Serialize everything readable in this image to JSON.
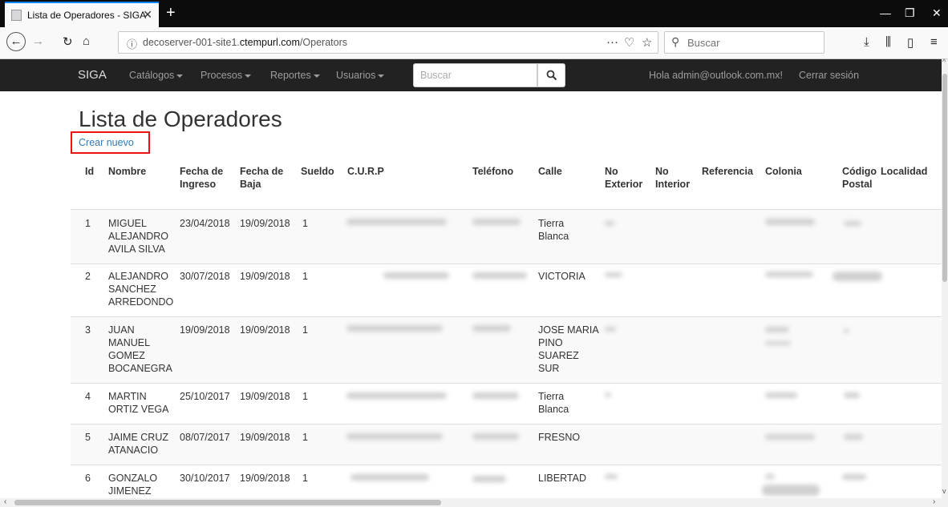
{
  "browser": {
    "tab_title": "Lista de Operadores - SIGA",
    "new_tab": "+",
    "url_prefix": "decoserver-001-site1.",
    "url_domain": "ctempurl.com",
    "url_path": "/Operators",
    "search_placeholder": "Buscar"
  },
  "nav": {
    "brand": "SIGA",
    "menus": [
      "Catálogos",
      "Procesos",
      "Reportes",
      "Usuarios"
    ],
    "search_placeholder": "Buscar",
    "greeting": "Hola admin@outlook.com.mx!",
    "logout": "Cerrar sesión"
  },
  "page": {
    "title": "Lista de Operadores",
    "create_link": "Crear nuevo"
  },
  "table": {
    "headers": {
      "id": "Id",
      "nombre": "Nombre",
      "ingreso1": "Fecha de",
      "ingreso2": "Ingreso",
      "baja1": "Fecha de",
      "baja2": "Baja",
      "sueldo": "Sueldo",
      "curp": "C.U.R.P",
      "telefono": "Teléfono",
      "calle": "Calle",
      "noext1": "No",
      "noext2": "Exterior",
      "noint1": "No",
      "noint2": "Interior",
      "referencia": "Referencia",
      "colonia": "Colonia",
      "cp1": "Código",
      "cp2": "Postal",
      "localidad": "Localidad"
    },
    "rows": [
      {
        "id": "1",
        "nombre": [
          "MIGUEL",
          "ALEJANDRO",
          "AVILA SILVA"
        ],
        "ingreso": "23/04/2018",
        "baja": "19/09/2018",
        "sueldo": "1",
        "calle": [
          "Tierra",
          "Blanca"
        ]
      },
      {
        "id": "2",
        "nombre": [
          "ALEJANDRO",
          "SANCHEZ",
          "ARREDONDO"
        ],
        "ingreso": "30/07/2018",
        "baja": "19/09/2018",
        "sueldo": "1",
        "calle": [
          "VICTORIA"
        ]
      },
      {
        "id": "3",
        "nombre": [
          "JUAN",
          "MANUEL",
          "GOMEZ",
          "BOCANEGRA"
        ],
        "ingreso": "19/09/2018",
        "baja": "19/09/2018",
        "sueldo": "1",
        "calle": [
          "JOSE MARIA",
          "PINO",
          "SUAREZ",
          "SUR"
        ]
      },
      {
        "id": "4",
        "nombre": [
          "MARTIN",
          "ORTIZ VEGA"
        ],
        "ingreso": "25/10/2017",
        "baja": "19/09/2018",
        "sueldo": "1",
        "calle": [
          "Tierra",
          "Blanca"
        ]
      },
      {
        "id": "5",
        "nombre": [
          "JAIME CRUZ",
          "ATANACIO"
        ],
        "ingreso": "08/07/2017",
        "baja": "19/09/2018",
        "sueldo": "1",
        "calle": [
          "FRESNO"
        ]
      },
      {
        "id": "6",
        "nombre": [
          "GONZALO",
          "JIMENEZ"
        ],
        "ingreso": "30/10/2017",
        "baja": "19/09/2018",
        "sueldo": "1",
        "calle": [
          "LIBERTAD"
        ]
      }
    ]
  }
}
